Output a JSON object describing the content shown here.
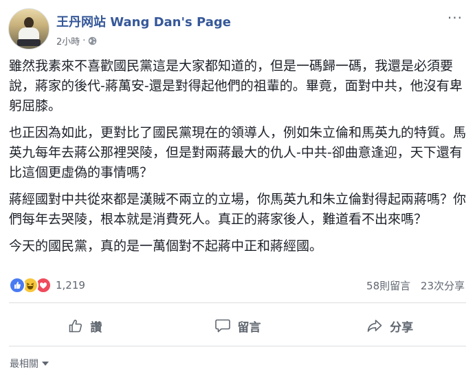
{
  "header": {
    "page_name": "王丹网站 Wang Dan's Page",
    "timestamp": "2小時",
    "separator": "·",
    "privacy_icon": "globe-icon",
    "more_icon": "ellipsis-icon",
    "more_glyph": "···"
  },
  "post": {
    "paragraphs": [
      "雖然我素來不喜歡國民黨這是大家都知道的，但是一碼歸一碼，我還是必須要說，蔣家的後代-蔣萬安-還是對得起他們的祖輩的。畢竟，面對中共，他沒有卑躬屈膝。",
      "也正因為如此，更對比了國民黨現在的領導人，例如朱立倫和馬英九的特質。馬英九每年去蔣公那裡哭陵，但是對兩蔣最大的仇人-中共-卻曲意逢迎，天下還有比這個更虛偽的事情嗎？",
      "蔣經國對中共從來都是漢賊不兩立的立場，你馬英九和朱立倫對得起兩蔣嗎？你們每年去哭陵，根本就是消費死人。真正的蔣家後人，難道看不出來嗎？",
      "今天的國民黨，真的是一萬個對不起蔣中正和蔣經國。"
    ]
  },
  "reactions": {
    "icons": [
      "like-icon",
      "haha-icon",
      "love-icon"
    ],
    "colors": {
      "like": "#4a7bf2",
      "haha": "#f7c63a",
      "love": "#ef4b5c"
    },
    "total": "1,219",
    "comments": "58則留言",
    "shares": "23次分享"
  },
  "actions": {
    "like_label": "讚",
    "comment_label": "留言",
    "share_label": "分享"
  },
  "comments": {
    "sort_label": "最相關"
  },
  "colors": {
    "page_name": "#365899",
    "text": "#1d2129",
    "muted": "#606770"
  }
}
